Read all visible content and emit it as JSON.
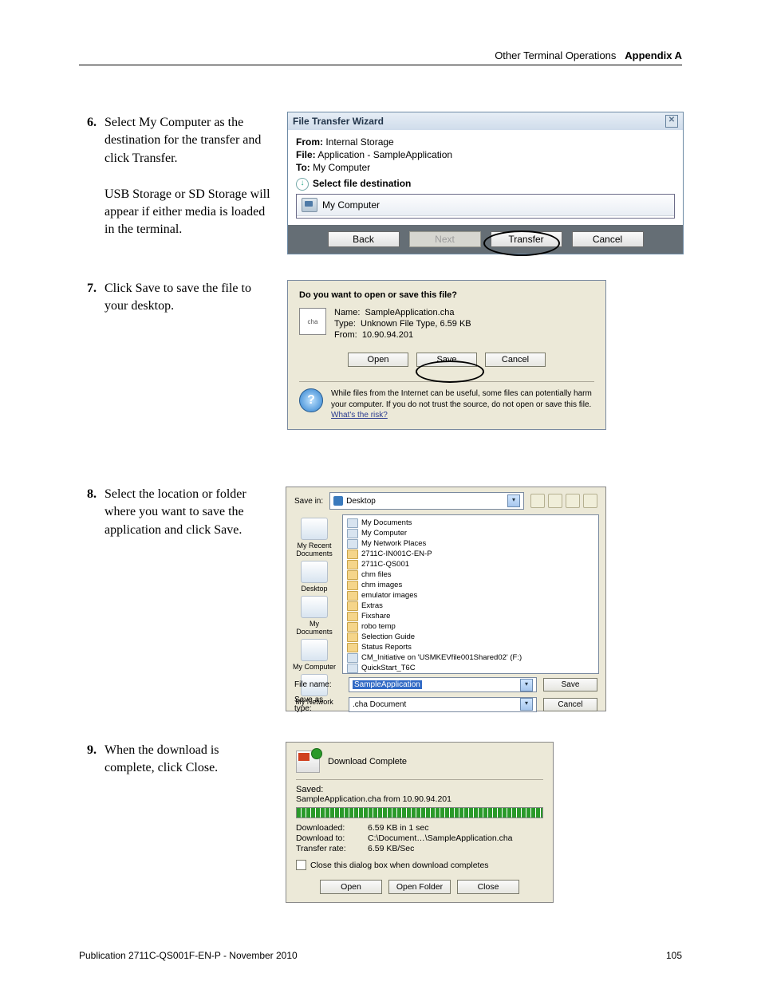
{
  "header": {
    "section": "Other Terminal Operations",
    "appendix": "Appendix A"
  },
  "steps": {
    "s6": {
      "num": "6.",
      "text": "Select My Computer as the destination for the transfer and click Transfer.",
      "note": "USB Storage or SD Storage will appear if either media is loaded in the terminal."
    },
    "s7": {
      "num": "7.",
      "text": "Click Save to save the file to your desktop."
    },
    "s8": {
      "num": "8.",
      "text": "Select the location or folder where you want to save the application and click Save."
    },
    "s9": {
      "num": "9.",
      "text": "When the download is complete, click Close."
    }
  },
  "ss1": {
    "title": "File Transfer Wizard",
    "from_lbl": "From:",
    "from_val": "Internal Storage",
    "file_lbl": "File:",
    "file_val": "Application - SampleApplication",
    "to_lbl": "To:",
    "to_val": "My Computer",
    "select_dest": "Select file destination",
    "item": "My Computer",
    "btn_back": "Back",
    "btn_next": "Next",
    "btn_transfer": "Transfer",
    "btn_cancel": "Cancel"
  },
  "ss2": {
    "question": "Do you want to open or save this file?",
    "name_lbl": "Name:",
    "name_val": "SampleApplication.cha",
    "type_lbl": "Type:",
    "type_val": "Unknown File Type, 6.59 KB",
    "from_lbl": "From:",
    "from_val": "10.90.94.201",
    "btn_open": "Open",
    "btn_save": "Save",
    "btn_cancel": "Cancel",
    "warn": "While files from the Internet can be useful, some files can potentially harm your computer. If you do not trust the source, do not open or save this file. ",
    "warn_link": "What's the risk?"
  },
  "ss3": {
    "savein_lbl": "Save in:",
    "savein_val": "Desktop",
    "places": [
      "My Recent Documents",
      "Desktop",
      "My Documents",
      "My Computer",
      "My Network"
    ],
    "items": [
      {
        "t": "My Documents",
        "s": true
      },
      {
        "t": "My Computer",
        "s": true
      },
      {
        "t": "My Network Places",
        "s": true
      },
      {
        "t": "2711C-IN001C-EN-P"
      },
      {
        "t": "2711C-QS001"
      },
      {
        "t": "chm files"
      },
      {
        "t": "chm images"
      },
      {
        "t": "emulator images"
      },
      {
        "t": "Extras"
      },
      {
        "t": "Fixshare"
      },
      {
        "t": "robo temp"
      },
      {
        "t": "Selection Guide"
      },
      {
        "t": "Status Reports"
      },
      {
        "t": "CM_Initiative on 'USMKEVfile001Shared02' (F:)",
        "s": true
      },
      {
        "t": "QuickStart_T6C",
        "s": true
      }
    ],
    "fname_lbl": "File name:",
    "fname_val": "SampleApplication",
    "ftype_lbl": "Save as type:",
    "ftype_val": ".cha Document",
    "btn_save": "Save",
    "btn_cancel": "Cancel"
  },
  "ss4": {
    "title": "Download Complete",
    "saved_lbl": "Saved:",
    "saved_val": "SampleApplication.cha from 10.90.94.201",
    "dl_lbl": "Downloaded:",
    "dl_val": "6.59 KB in 1 sec",
    "to_lbl": "Download to:",
    "to_val": "C:\\Document…\\SampleApplication.cha",
    "rate_lbl": "Transfer rate:",
    "rate_val": "6.59 KB/Sec",
    "chk": "Close this dialog box when download completes",
    "btn_open": "Open",
    "btn_folder": "Open Folder",
    "btn_close": "Close"
  },
  "footer": {
    "pub": "Publication 2711C-QS001F-EN-P - November 2010",
    "page": "105"
  }
}
